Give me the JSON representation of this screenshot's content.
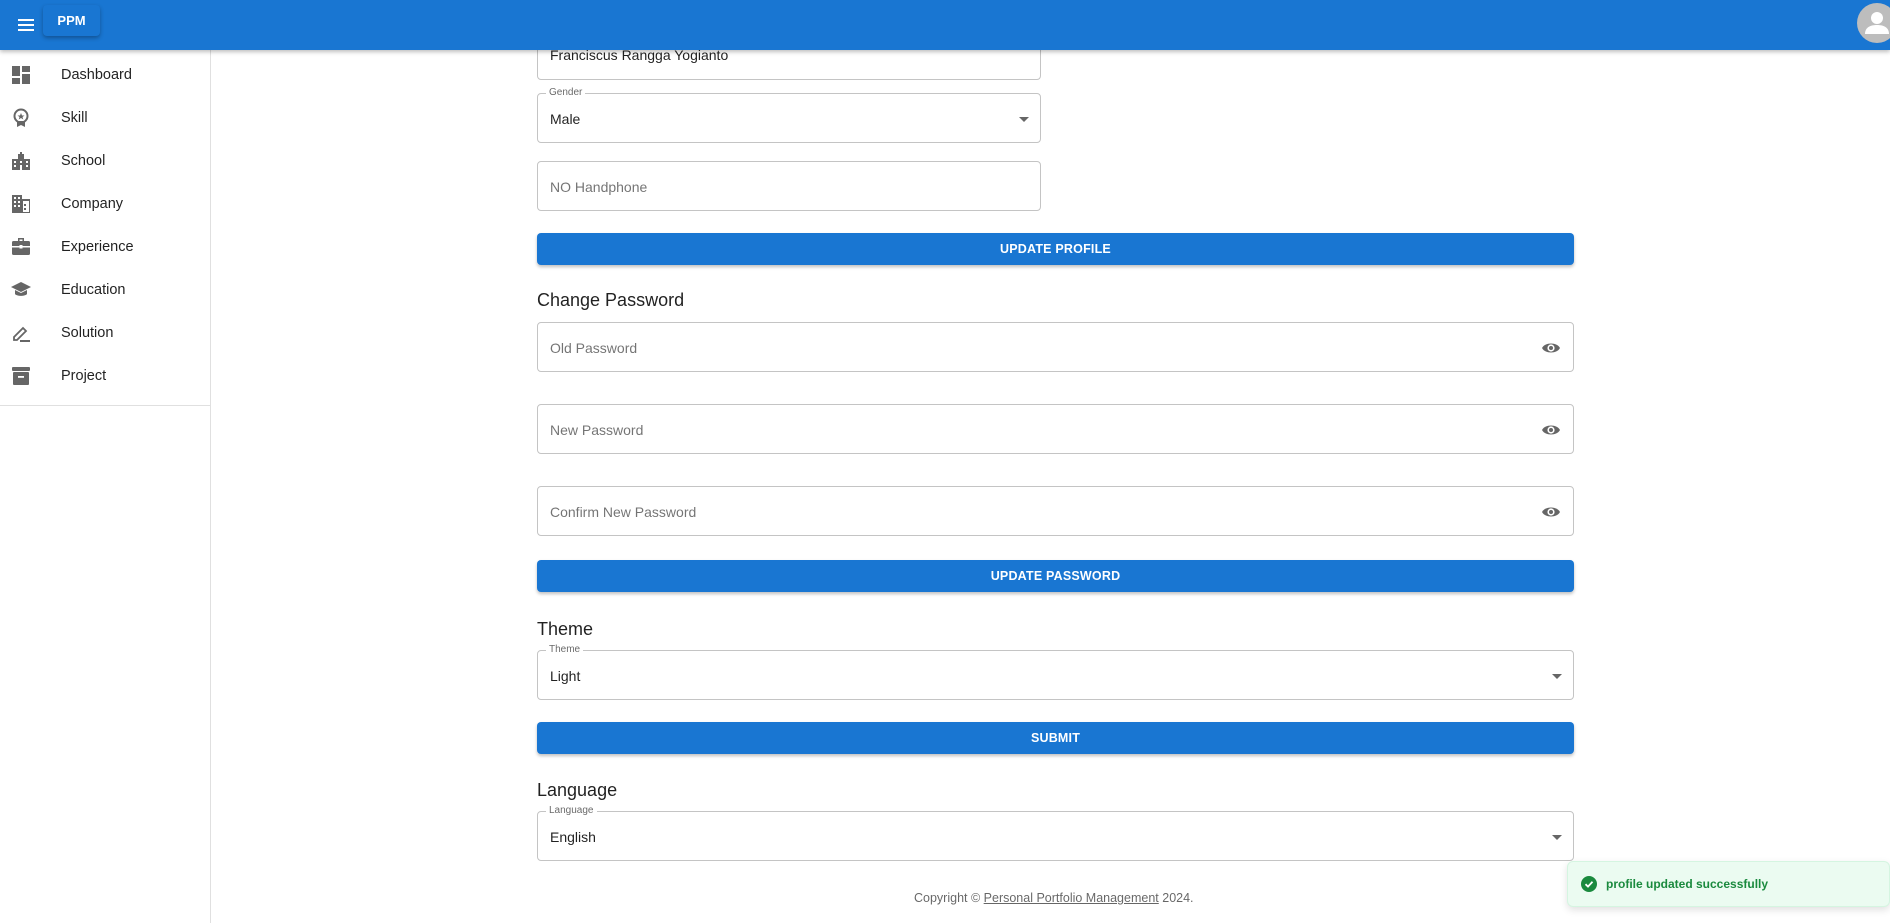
{
  "appbar": {
    "brand_label": "PPM",
    "menu_icon": "menu-icon",
    "avatar_icon": "account-circle-icon",
    "color": "#1976d2"
  },
  "sidebar": {
    "items": [
      {
        "label": "Dashboard",
        "icon": "dashboard-icon"
      },
      {
        "label": "Skill",
        "icon": "award-icon"
      },
      {
        "label": "School",
        "icon": "school-building-icon"
      },
      {
        "label": "Company",
        "icon": "company-building-icon"
      },
      {
        "label": "Experience",
        "icon": "briefcase-icon"
      },
      {
        "label": "Education",
        "icon": "graduation-cap-icon"
      },
      {
        "label": "Solution",
        "icon": "pen-icon"
      },
      {
        "label": "Project",
        "icon": "archive-icon"
      }
    ]
  },
  "profile": {
    "name_value": "Franciscus Rangga Yogianto",
    "gender_label": "Gender",
    "gender_value": "Male",
    "phone_placeholder": "NO Handphone",
    "update_button": "UPDATE PROFILE"
  },
  "password": {
    "title": "Change Password",
    "old_placeholder": "Old Password",
    "new_placeholder": "New Password",
    "confirm_placeholder": "Confirm New Password",
    "update_button": "UPDATE PASSWORD"
  },
  "theme": {
    "title": "Theme",
    "field_label": "Theme",
    "value": "Light",
    "submit_button": "SUBMIT"
  },
  "language": {
    "title": "Language",
    "field_label": "Language",
    "value": "English"
  },
  "footer": {
    "prefix": "Copyright © ",
    "link": "Personal Portfolio Management",
    "suffix": " 2024."
  },
  "toast": {
    "message": "profile updated successfully",
    "icon": "check-circle-icon",
    "color": "#1a8a3e"
  }
}
